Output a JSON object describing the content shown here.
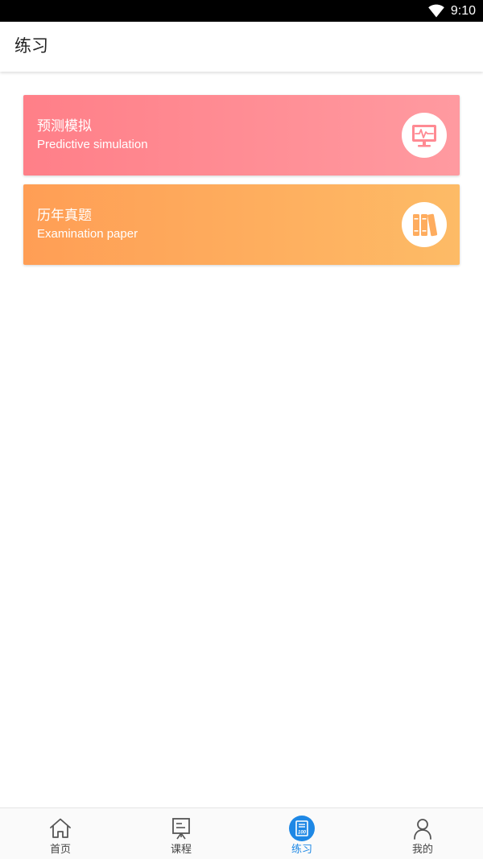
{
  "status_bar": {
    "time": "9:10",
    "wifi_icon": "wifi-icon"
  },
  "header": {
    "title": "练习"
  },
  "cards": [
    {
      "title": "预测模拟",
      "subtitle": "Predictive simulation",
      "icon": "monitor-pulse-icon",
      "color": "#ff8a93"
    },
    {
      "title": "历年真题",
      "subtitle": "Examination paper",
      "icon": "books-icon",
      "color": "#feac5e"
    }
  ],
  "bottom_nav": {
    "active_color": "#1e88e5",
    "items": [
      {
        "label": "首页",
        "icon": "home-icon",
        "active": false
      },
      {
        "label": "课程",
        "icon": "presentation-board-icon",
        "active": false
      },
      {
        "label": "练习",
        "icon": "score-100-icon",
        "active": true
      },
      {
        "label": "我的",
        "icon": "user-icon",
        "active": false
      }
    ]
  }
}
